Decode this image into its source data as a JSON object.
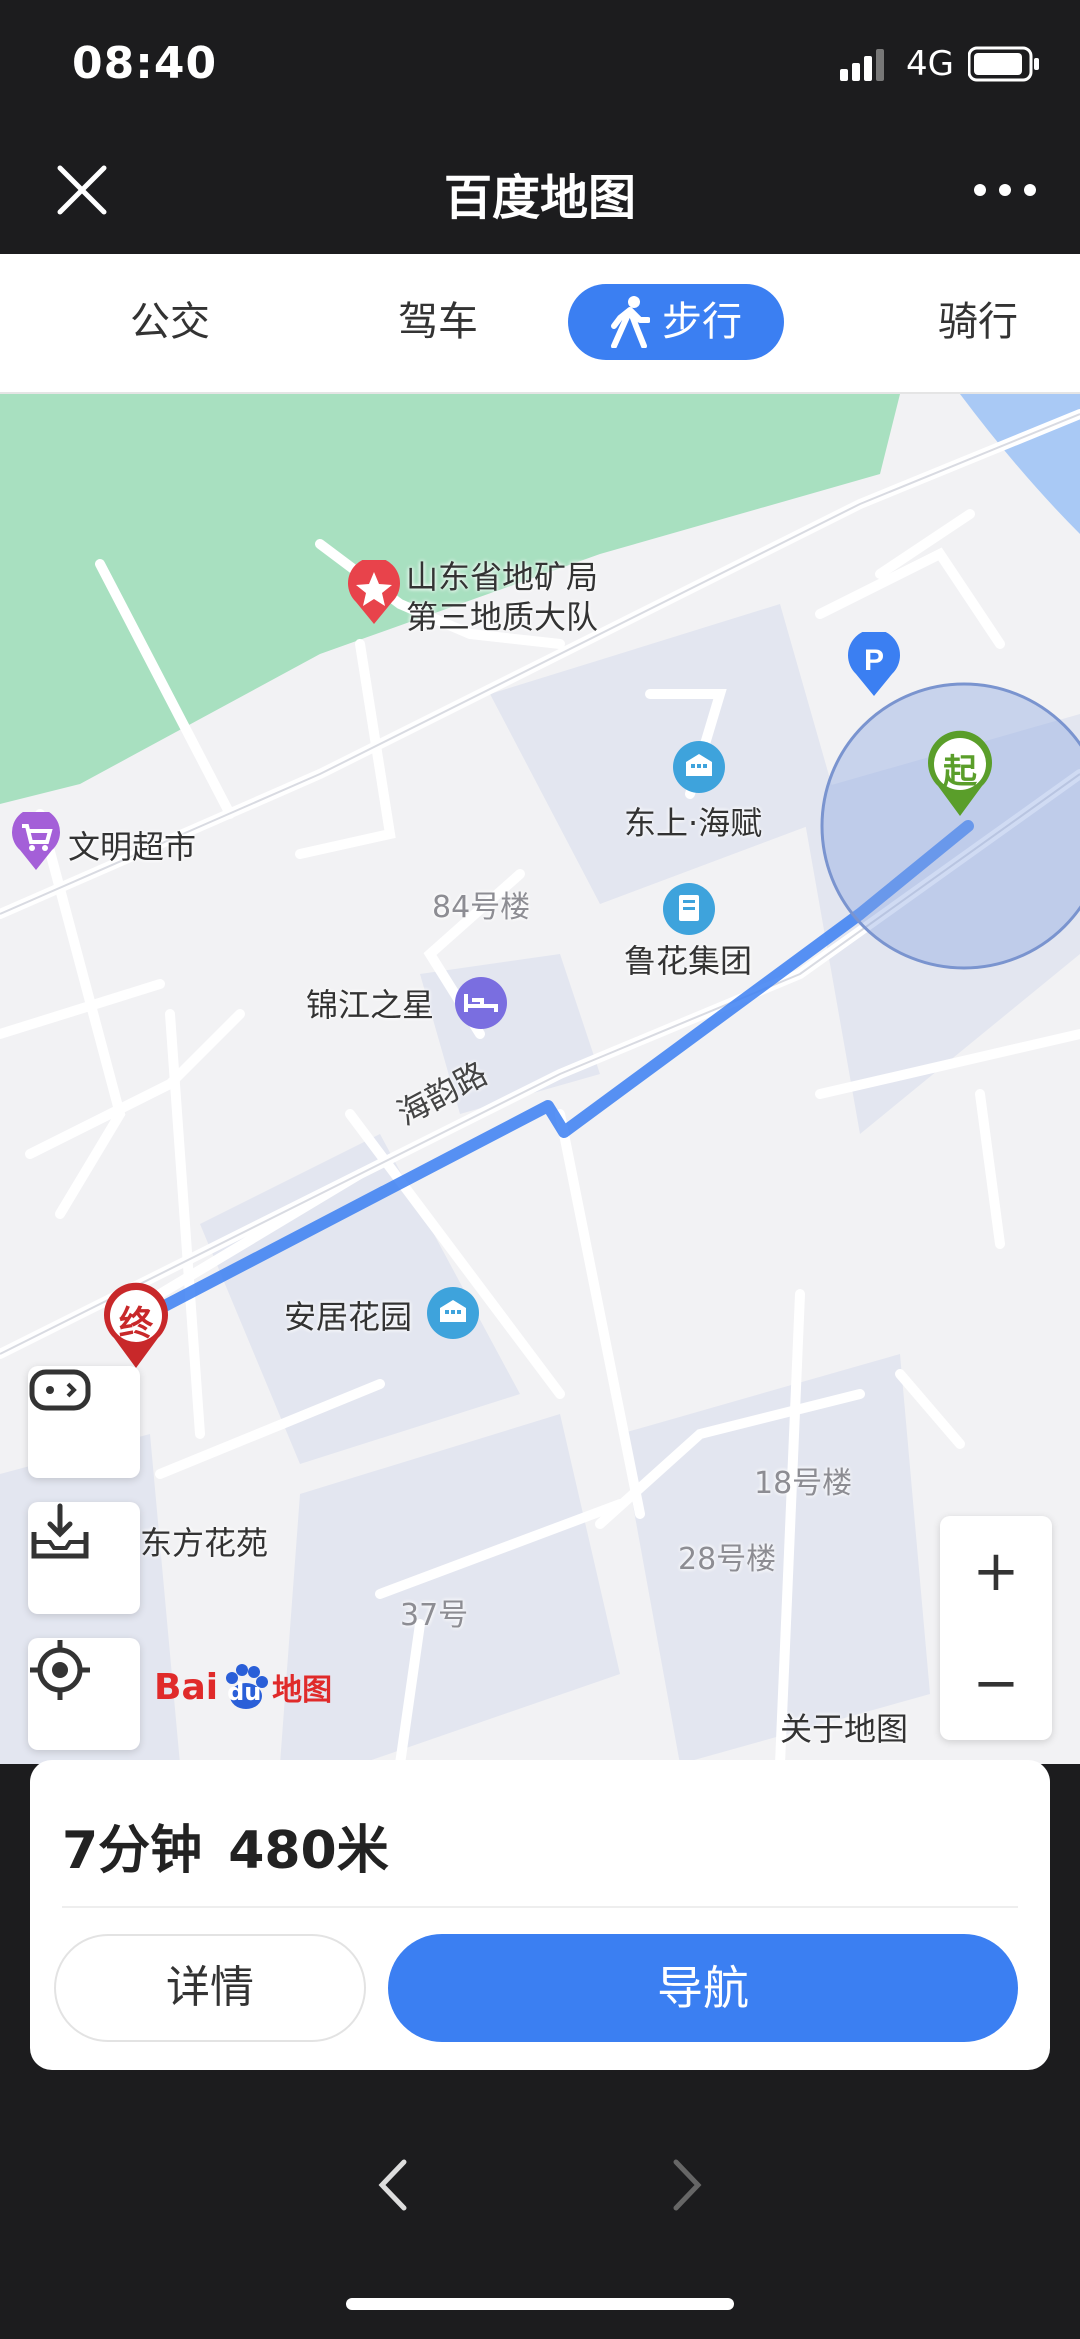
{
  "status_bar": {
    "time": "08:40",
    "network": "4G"
  },
  "header": {
    "title": "百度地图"
  },
  "mode_tabs": [
    {
      "label": "公交"
    },
    {
      "label": "驾车"
    },
    {
      "label": "步行",
      "active": true
    },
    {
      "label": "骑行"
    }
  ],
  "map": {
    "pois": {
      "survey_team_line1": "山东省地矿局",
      "survey_team_line2": "第三地质大队",
      "supermarket": "文明超市",
      "dongshang": "东上·海赋",
      "building84": "84号楼",
      "luhua": "鲁花集团",
      "jinjiang": "锦江之星",
      "anju": "安居花园",
      "building18": "18号楼",
      "dongfang": "东方花苑",
      "building28": "28号楼",
      "building37": "37号"
    },
    "road_name": "海韵路",
    "start_marker": "起",
    "end_marker": "终",
    "logo": {
      "bai": "Bai",
      "du": "du",
      "suffix": "地图"
    },
    "about": "关于地图",
    "zoom_in": "+",
    "zoom_out": "−"
  },
  "route": {
    "time": "7分钟",
    "distance": "480米"
  },
  "actions": {
    "detail": "详情",
    "navigate": "导航"
  },
  "colors": {
    "accent": "#3b7ff2",
    "green_area": "#a8e0c0",
    "water": "#a9c9f5"
  }
}
